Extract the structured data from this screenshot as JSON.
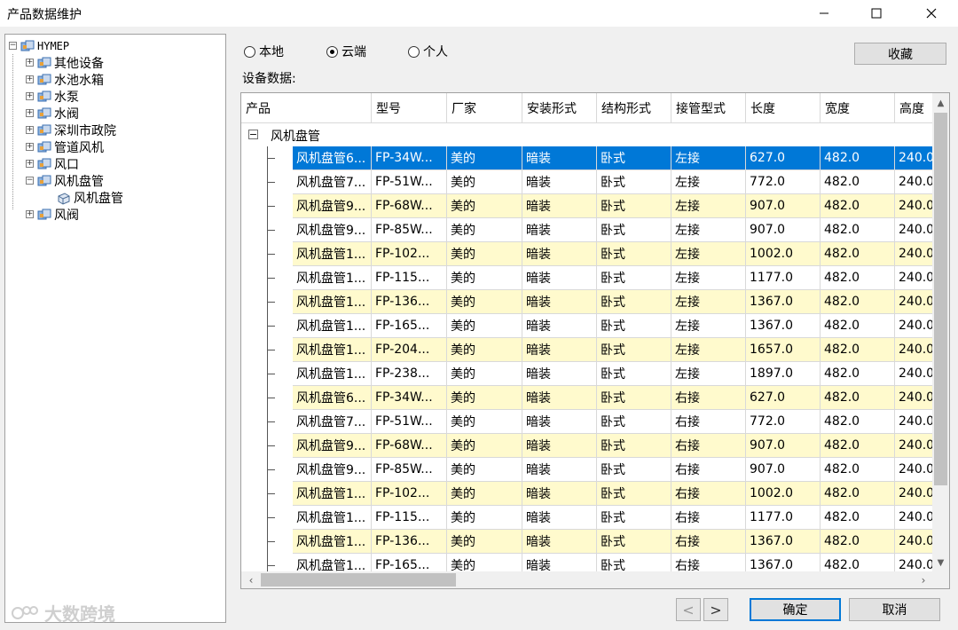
{
  "window": {
    "title": "产品数据维护"
  },
  "tree": {
    "root": "HYMEP",
    "items": [
      {
        "label": "其他设备",
        "expanded": false
      },
      {
        "label": "水池水箱",
        "expanded": false
      },
      {
        "label": "水泵",
        "expanded": false
      },
      {
        "label": "水阀",
        "expanded": false
      },
      {
        "label": "深圳市政院",
        "expanded": false
      },
      {
        "label": "管道风机",
        "expanded": false
      },
      {
        "label": "风口",
        "expanded": false
      },
      {
        "label": "风机盘管",
        "expanded": true
      },
      {
        "label": "风阀",
        "expanded": false
      }
    ],
    "child": {
      "label": "风机盘管"
    }
  },
  "source": {
    "options": [
      "本地",
      "云端",
      "个人"
    ],
    "selected": "云端"
  },
  "buttons": {
    "favorite": "收藏",
    "ok": "确定",
    "cancel": "取消"
  },
  "grid": {
    "section_label": "设备数据:",
    "columns": [
      "产品",
      "型号",
      "厂家",
      "安装形式",
      "结构形式",
      "接管型式",
      "长度",
      "宽度",
      "高度"
    ],
    "group": {
      "label": "风机盘管",
      "toggle": "−"
    },
    "rows": [
      [
        "风机盘管6...",
        "FP-34W...",
        "美的",
        "暗装",
        "卧式",
        "左接",
        "627.0",
        "482.0",
        "240.0"
      ],
      [
        "风机盘管7...",
        "FP-51W...",
        "美的",
        "暗装",
        "卧式",
        "左接",
        "772.0",
        "482.0",
        "240.0"
      ],
      [
        "风机盘管9...",
        "FP-68W...",
        "美的",
        "暗装",
        "卧式",
        "左接",
        "907.0",
        "482.0",
        "240.0"
      ],
      [
        "风机盘管9...",
        "FP-85W...",
        "美的",
        "暗装",
        "卧式",
        "左接",
        "907.0",
        "482.0",
        "240.0"
      ],
      [
        "风机盘管1...",
        "FP-102...",
        "美的",
        "暗装",
        "卧式",
        "左接",
        "1002.0",
        "482.0",
        "240.0"
      ],
      [
        "风机盘管1...",
        "FP-115...",
        "美的",
        "暗装",
        "卧式",
        "左接",
        "1177.0",
        "482.0",
        "240.0"
      ],
      [
        "风机盘管1...",
        "FP-136...",
        "美的",
        "暗装",
        "卧式",
        "左接",
        "1367.0",
        "482.0",
        "240.0"
      ],
      [
        "风机盘管1...",
        "FP-165...",
        "美的",
        "暗装",
        "卧式",
        "左接",
        "1367.0",
        "482.0",
        "240.0"
      ],
      [
        "风机盘管1...",
        "FP-204...",
        "美的",
        "暗装",
        "卧式",
        "左接",
        "1657.0",
        "482.0",
        "240.0"
      ],
      [
        "风机盘管1...",
        "FP-238...",
        "美的",
        "暗装",
        "卧式",
        "左接",
        "1897.0",
        "482.0",
        "240.0"
      ],
      [
        "风机盘管6...",
        "FP-34W...",
        "美的",
        "暗装",
        "卧式",
        "右接",
        "627.0",
        "482.0",
        "240.0"
      ],
      [
        "风机盘管7...",
        "FP-51W...",
        "美的",
        "暗装",
        "卧式",
        "右接",
        "772.0",
        "482.0",
        "240.0"
      ],
      [
        "风机盘管9...",
        "FP-68W...",
        "美的",
        "暗装",
        "卧式",
        "右接",
        "907.0",
        "482.0",
        "240.0"
      ],
      [
        "风机盘管9...",
        "FP-85W...",
        "美的",
        "暗装",
        "卧式",
        "右接",
        "907.0",
        "482.0",
        "240.0"
      ],
      [
        "风机盘管1...",
        "FP-102...",
        "美的",
        "暗装",
        "卧式",
        "右接",
        "1002.0",
        "482.0",
        "240.0"
      ],
      [
        "风机盘管1...",
        "FP-115...",
        "美的",
        "暗装",
        "卧式",
        "右接",
        "1177.0",
        "482.0",
        "240.0"
      ],
      [
        "风机盘管1...",
        "FP-136...",
        "美的",
        "暗装",
        "卧式",
        "右接",
        "1367.0",
        "482.0",
        "240.0"
      ],
      [
        "风机盘管1...",
        "FP-165...",
        "美的",
        "暗装",
        "卧式",
        "右接",
        "1367.0",
        "482.0",
        "240.0"
      ]
    ],
    "selected_row": 0
  },
  "pager": {
    "prev": "<",
    "next": ">"
  },
  "watermark": {
    "text": "大数跨境"
  },
  "colors": {
    "accent": "#0078d7",
    "row_alt": "#fffacd",
    "selected_text": "#ffffff"
  },
  "icons": [
    "minimize-icon",
    "maximize-icon",
    "close-icon",
    "folder-icon",
    "device-icon"
  ]
}
